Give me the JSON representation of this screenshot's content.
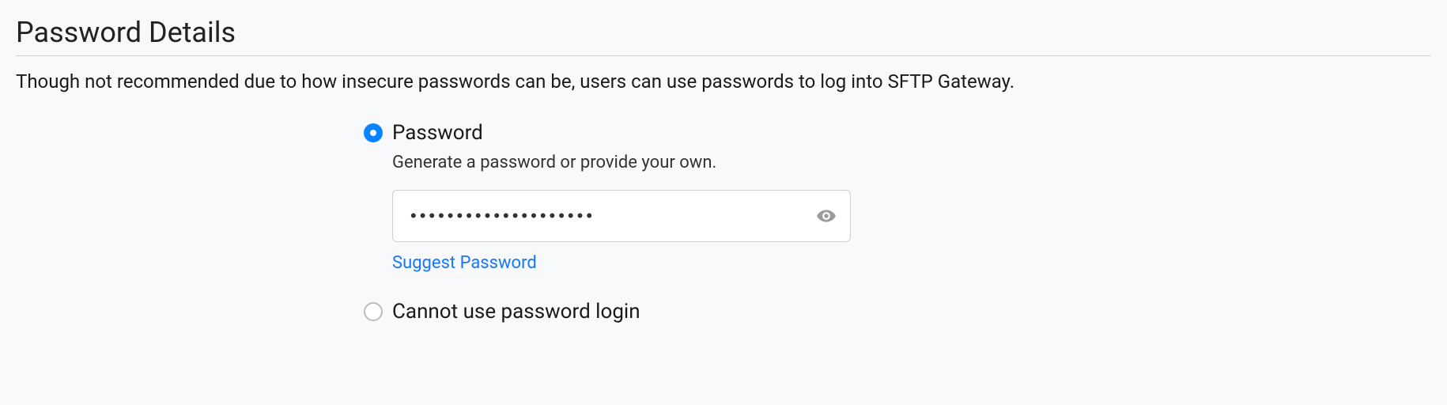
{
  "section": {
    "title": "Password Details",
    "description": "Though not recommended due to how insecure passwords can be, users can use passwords to log into SFTP Gateway."
  },
  "options": {
    "password": {
      "label": "Password",
      "helper": "Generate a password or provide your own.",
      "value": "••••••••••••••••••••",
      "suggest_label": "Suggest Password"
    },
    "cannot": {
      "label": "Cannot use password login"
    }
  }
}
